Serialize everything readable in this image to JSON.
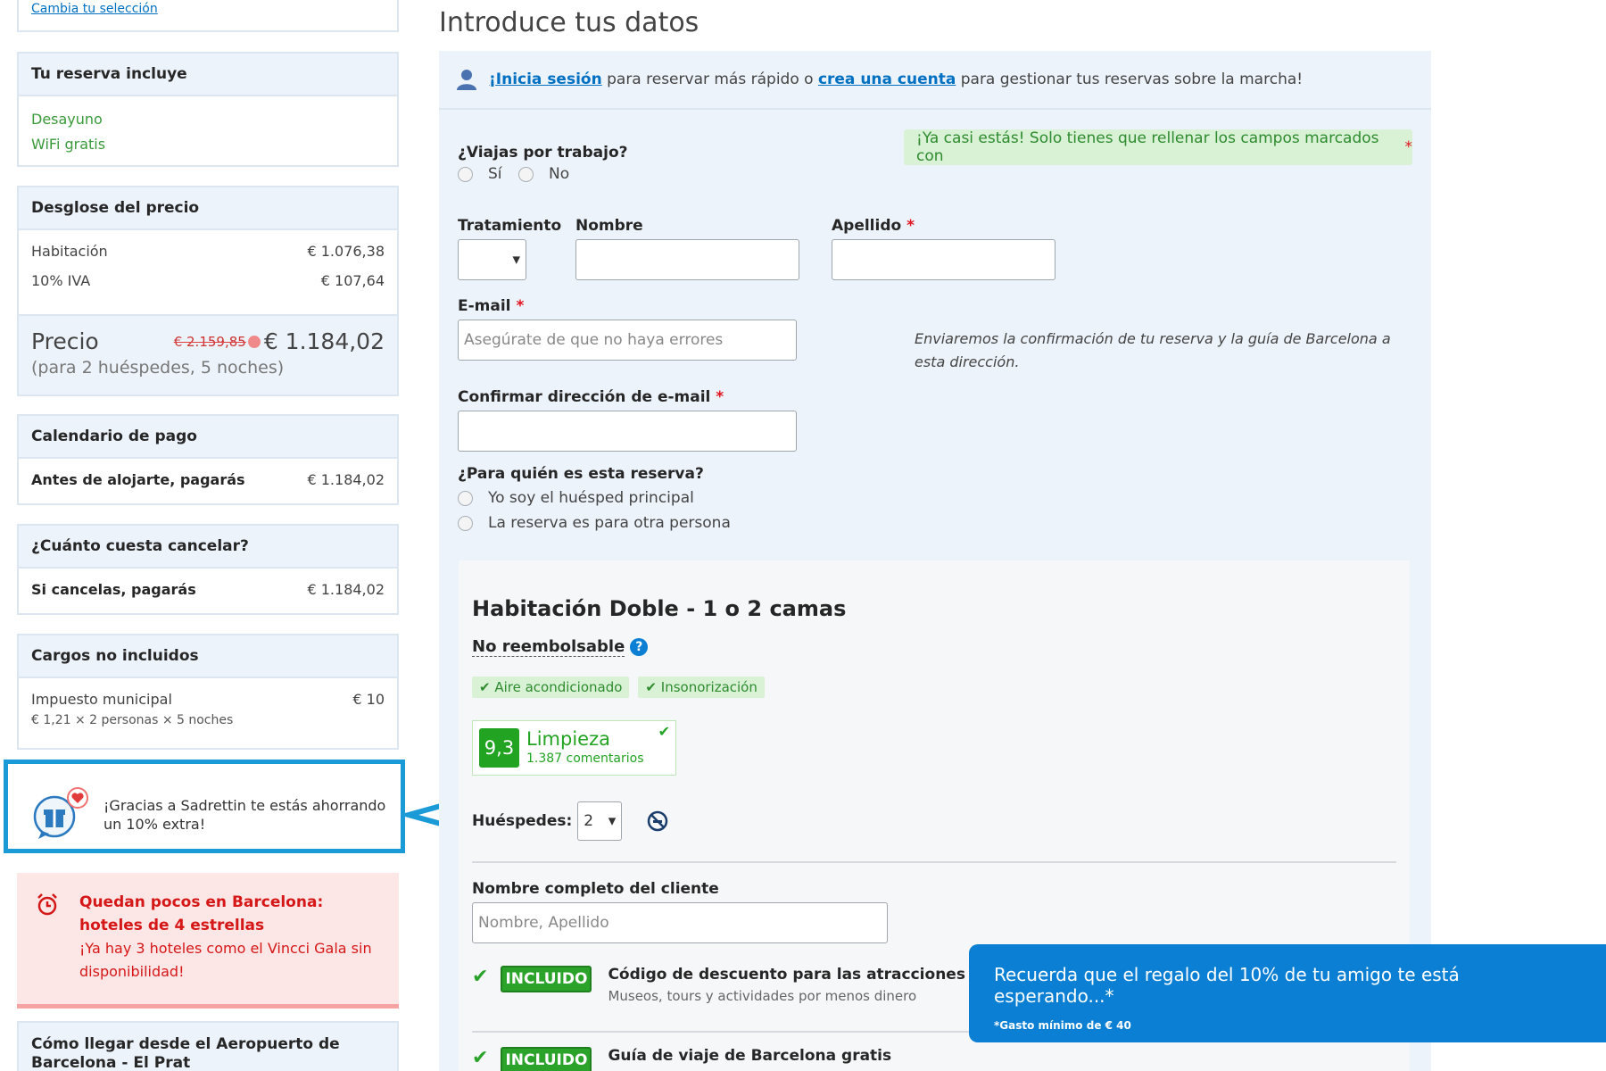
{
  "sidebar": {
    "change_selection": "Cambia tu selección",
    "includes": {
      "title": "Tu reserva incluye",
      "items": [
        "Desayuno",
        "WiFi gratis"
      ]
    },
    "breakdown": {
      "title": "Desglose del precio",
      "rows": [
        {
          "label": "Habitación",
          "value": "€ 1.076,38"
        },
        {
          "label": "10% IVA",
          "value": "€ 107,64"
        }
      ],
      "price_label": "Precio",
      "old_price": "€ 2.159,85",
      "price": "€ 1.184,02",
      "price_note": "(para 2 huéspedes, 5 noches)"
    },
    "payment": {
      "title": "Calendario de pago",
      "label": "Antes de alojarte, pagarás",
      "value": "€ 1.184,02"
    },
    "cancel": {
      "title": "¿Cuánto cuesta cancelar?",
      "label": "Si cancelas, pagarás",
      "value": "€ 1.184,02"
    },
    "charges": {
      "title": "Cargos no incluidos",
      "label": "Impuesto municipal",
      "value": "€ 10",
      "detail": "€ 1,21  ×  2 personas  ×  5 noches"
    },
    "referral": "¡Gracias a Sadrettin te estás ahorrando un 10% extra!",
    "alert": {
      "title": "Quedan pocos en Barcelona: hoteles de 4 estrellas",
      "sub": "¡Ya hay 3 hoteles como el Vincci Gala sin disponibilidad!"
    },
    "airport": "Cómo llegar desde el Aeropuerto de Barcelona - El Prat"
  },
  "main": {
    "title": "Introduce tus datos",
    "signin": {
      "pre": "¡",
      "login": "Inicia sesión",
      "mid": " para reservar más rápido o ",
      "create": "crea una cuenta",
      "post": " para gestionar tus reservas sobre la marcha!"
    },
    "required_note": "¡Ya casi estás! Solo tienes que rellenar los campos marcados con",
    "required_star": "*",
    "business": {
      "label": "¿Viajas por trabajo?",
      "yes": "Sí",
      "no": "No"
    },
    "title_label": "Tratamiento",
    "first_name_label": "Nombre",
    "last_name_label": "Apellido",
    "email_label": "E-mail",
    "email_placeholder": "Asegúrate de que no haya errores",
    "email_note": "Enviaremos la confirmación de tu reserva y la guía de Barcelona a esta dirección.",
    "confirm_email_label": "Confirmar dirección de e-mail",
    "booking_for": {
      "label": "¿Para quién es esta reserva?",
      "opt1": "Yo soy el huésped principal",
      "opt2": "La reserva es para otra persona"
    },
    "room": {
      "name": "Habitación Doble - 1 o 2 camas",
      "policy": "No reembolsable",
      "tags": [
        "Aire acondicionado",
        "Insonorización"
      ],
      "score": "9,3",
      "score_label": "Limpieza",
      "reviews": "1.387 comentarios",
      "guests_label": "Huéspedes:",
      "guests_value": "2",
      "fullname_label": "Nombre completo del cliente",
      "fullname_placeholder": "Nombre, Apellido",
      "included_badge": "INCLUIDO",
      "extras": [
        {
          "title": "Código de descuento para las atracciones turísticas",
          "sub": "Museos, tours y actividades por menos dinero"
        },
        {
          "title": "Guía de viaje de Barcelona gratis",
          "sub": ""
        }
      ]
    }
  },
  "toast": {
    "text": "Recuerda que el regalo del 10% de tu amigo te está esperando...*",
    "note": "*Gasto mínimo de € 40"
  },
  "colors": {
    "accent_blue": "#0071c2",
    "highlight": "#1a9ad6",
    "green": "#2ba32b",
    "alert_red": "#d61717",
    "panel": "#edf3fa"
  }
}
